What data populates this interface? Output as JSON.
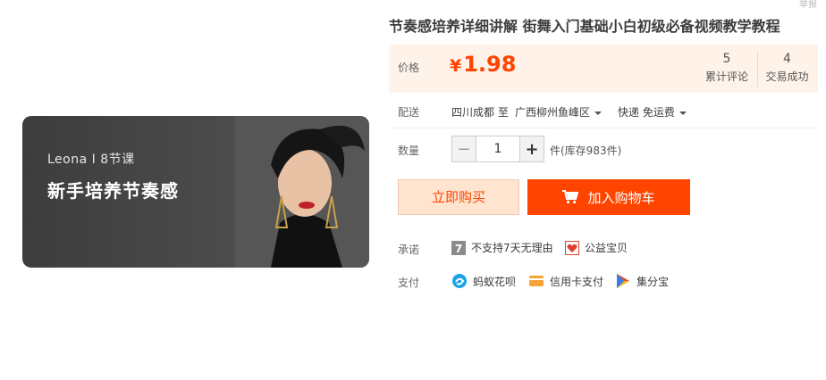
{
  "banner": {
    "subtitle": "Leona  I  8节课",
    "title": "新手培养节奏感"
  },
  "corner_text": "举报",
  "product": {
    "title": "节奏感培养详细讲解 街舞入门基础小白初级必备视频教学教程"
  },
  "price": {
    "label": "价格",
    "currency": "¥",
    "value": "1.98",
    "color": "#ff4400"
  },
  "stats": [
    {
      "num": "5",
      "label": "累计评论"
    },
    {
      "num": "4",
      "label": "交易成功"
    }
  ],
  "delivery": {
    "label": "配送",
    "from": "四川成都 至",
    "to": "广西柳州鱼峰区",
    "method": "快递 免运费"
  },
  "quantity": {
    "label": "数量",
    "value": "1",
    "minus": "−",
    "plus": "+",
    "stock": "件(库存983件)"
  },
  "actions": {
    "buy_now": "立即购买",
    "add_to_cart": "加入购物车"
  },
  "promise": {
    "label": "承诺",
    "items": [
      {
        "icon": "seven-days-icon",
        "text": "不支持7天无理由"
      },
      {
        "icon": "charity-heart-icon",
        "text": "公益宝贝"
      }
    ]
  },
  "payment": {
    "label": "支付",
    "items": [
      {
        "icon": "huabei-icon",
        "text": "蚂蚁花呗"
      },
      {
        "icon": "credit-card-icon",
        "text": "信用卡支付"
      },
      {
        "icon": "jifenbao-icon",
        "text": "集分宝"
      }
    ]
  }
}
